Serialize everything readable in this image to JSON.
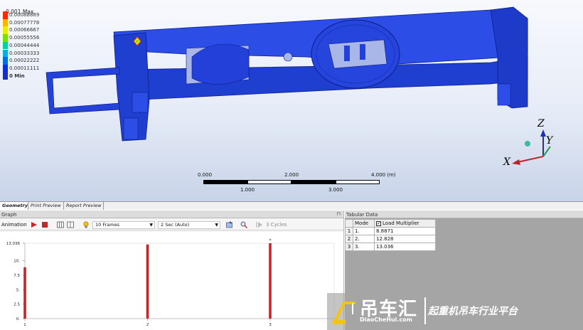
{
  "legend": {
    "title": "0.001 Max",
    "items": [
      {
        "label": "0.00088889",
        "color": "#ff2a00"
      },
      {
        "label": "0.00077778",
        "color": "#ffb400"
      },
      {
        "label": "0.00066667",
        "color": "#e7ee00"
      },
      {
        "label": "0.00055556",
        "color": "#7be000"
      },
      {
        "label": "0.00044444",
        "color": "#00d2a0"
      },
      {
        "label": "0.00033333",
        "color": "#00b2e4"
      },
      {
        "label": "0.00022222",
        "color": "#0070e0"
      },
      {
        "label": "0.00011111",
        "color": "#0b2ee0"
      }
    ],
    "min_label": "0 Min",
    "min_color": "#1a2fc0"
  },
  "scale": {
    "top_labels": [
      "0.000",
      "2.000",
      "4.000 (m)"
    ],
    "bottom_labels": [
      "1.000",
      "3.000"
    ]
  },
  "triad": {
    "z": "Z",
    "y": "Y",
    "x": "X"
  },
  "tabs": [
    "Geometry",
    "Print Preview",
    "Report Preview"
  ],
  "graph": {
    "title": "Graph",
    "animation_label": "Animation",
    "frames": "10 Frames",
    "duration": "2 Sec (Auto)",
    "cycles": "3 Cycles"
  },
  "tabular": {
    "title": "Tabular Data",
    "columns": [
      "Mode",
      "Load Multiplier"
    ],
    "rows": [
      {
        "num": "1",
        "mode": "1.",
        "value": "8.8871"
      },
      {
        "num": "2",
        "mode": "2.",
        "value": "12.828"
      },
      {
        "num": "3",
        "mode": "3.",
        "value": "13.036"
      }
    ]
  },
  "colors": {
    "model_blue": "#1f3fdc",
    "bar_red": "#c1272d",
    "accent": "#1a2fc0"
  },
  "chart_data": {
    "type": "bar",
    "categories": [
      "1",
      "2",
      "3"
    ],
    "values": [
      8.8871,
      12.828,
      13.036
    ],
    "ylim": [
      0,
      13.036
    ],
    "yticks": [
      "0.",
      "2.5",
      "5.",
      "7.5",
      "10.",
      "13.036"
    ],
    "ytick_values": [
      0,
      2.5,
      5,
      7.5,
      10,
      13.036
    ],
    "peak_marker": "*",
    "grid": false
  },
  "watermark": {
    "main": "吊车汇",
    "url": "DiaoCheHui.com",
    "slogan": "起重机吊车行业平台"
  }
}
